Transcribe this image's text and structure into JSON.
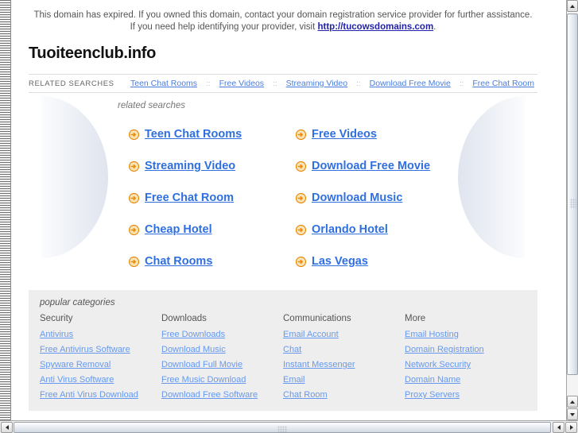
{
  "notice": {
    "text_before": "This domain has expired. If you owned this domain, contact your domain registration service provider for further assistance. If you need help identifying your provider, visit ",
    "link_text": "http://tucowsdomains.com",
    "text_after": "."
  },
  "domain_title": "Tuoiteenclub.info",
  "nav": {
    "label": "RELATED SEARCHES",
    "separator": "::",
    "items": [
      "Teen Chat Rooms",
      "Free Videos",
      "Streaming Video",
      "Download Free Movie",
      "Free Chat Room"
    ]
  },
  "related": {
    "heading": "related searches",
    "links": [
      "Teen Chat Rooms",
      "Free Videos",
      "Streaming Video",
      "Download Free Movie",
      "Free Chat Room",
      "Download Music",
      "Cheap Hotel",
      "Orlando Hotel",
      "Chat Rooms",
      "Las Vegas"
    ]
  },
  "categories": {
    "heading": "popular categories",
    "columns": [
      {
        "title": "Security",
        "links": [
          "Antivirus",
          "Free Antivirus Software",
          "Spyware Removal",
          "Anti Virus Software",
          "Free Anti Virus Download"
        ]
      },
      {
        "title": "Downloads",
        "links": [
          "Free Downloads",
          "Download Music",
          "Download Full Movie",
          "Free Music Download",
          "Download Free Software"
        ]
      },
      {
        "title": "Communications",
        "links": [
          "Email Account",
          "Chat",
          "Instant Messenger",
          "Email",
          "Chat Room"
        ]
      },
      {
        "title": "More",
        "links": [
          "Email Hosting",
          "Domain Registration",
          "Network Security",
          "Domain Name",
          "Proxy Servers"
        ]
      }
    ]
  },
  "colors": {
    "link_blue": "#2f6fe0",
    "nav_link_blue": "#4a7ddd",
    "footer_link_blue": "#6699ee",
    "bullet_orange": "#f08a00",
    "notice_link": "#2222aa",
    "footer_bg": "#eeeeee"
  },
  "icons": {
    "bullet": "circle-arrow-right-icon",
    "scroll_up": "scroll-up-arrow-icon",
    "scroll_down": "scroll-down-arrow-icon",
    "scroll_left": "scroll-left-arrow-icon",
    "scroll_right": "scroll-right-arrow-icon"
  }
}
